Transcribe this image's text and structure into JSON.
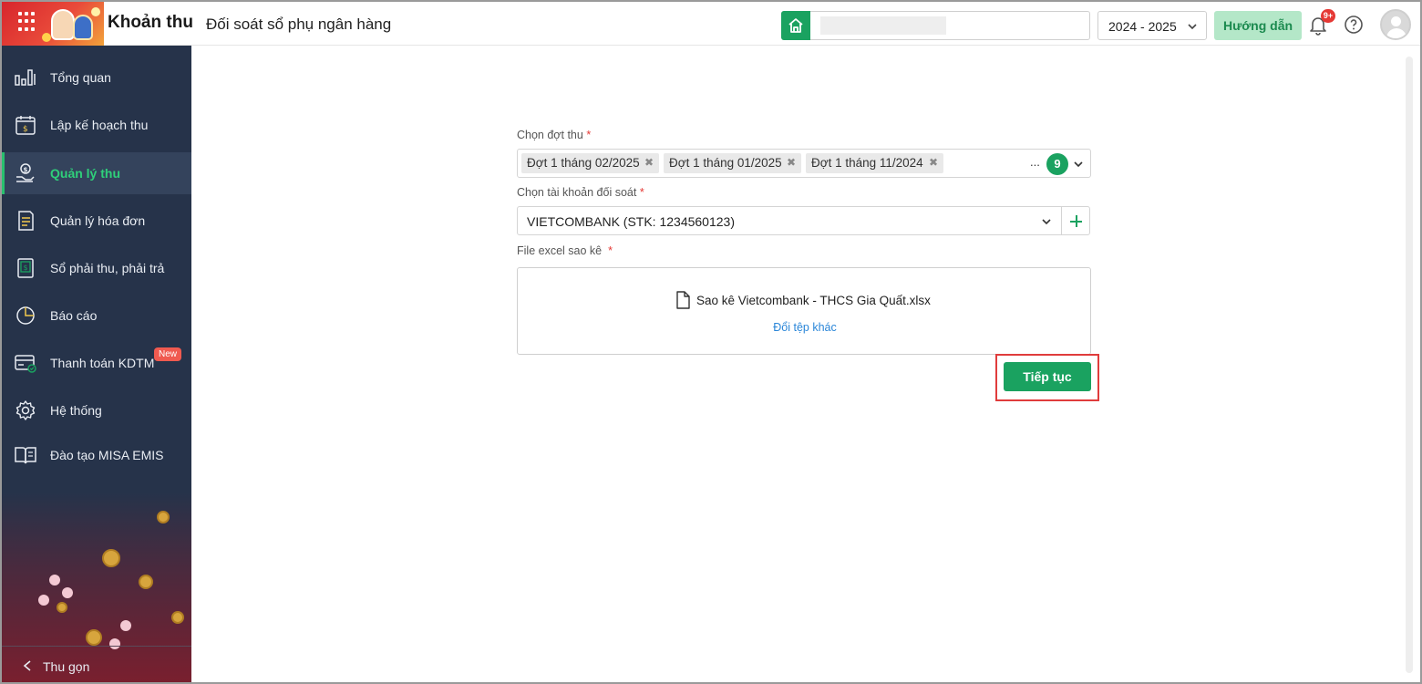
{
  "header": {
    "app_title": "Khoản thu",
    "page_title": "Đối soát sổ phụ ngân hàng",
    "school_year": "2024 - 2025",
    "guide_label": "Hướng dẫn",
    "notification_count": "9+"
  },
  "sidebar": {
    "items": [
      {
        "label": "Tổng quan",
        "icon": "bar-chart-icon"
      },
      {
        "label": "Lập kế hoạch thu",
        "icon": "calendar-money-icon"
      },
      {
        "label": "Quản lý thu",
        "icon": "hand-coin-icon",
        "active": true
      },
      {
        "label": "Quản lý hóa đơn",
        "icon": "invoice-icon"
      },
      {
        "label": "Sổ phải thu, phải trả",
        "icon": "ledger-icon"
      },
      {
        "label": "Báo cáo",
        "icon": "pie-chart-icon"
      },
      {
        "label": "Thanh toán KDTM",
        "icon": "card-payment-icon",
        "badge": "New"
      },
      {
        "label": "Hệ thống",
        "icon": "gear-icon"
      },
      {
        "label": "Đào tạo MISA EMIS",
        "icon": "book-icon"
      }
    ],
    "collapse_label": "Thu gọn"
  },
  "form": {
    "period_label": "Chọn đợt thu",
    "period_tags": [
      "Đợt 1 tháng 02/2025",
      "Đợt 1 tháng 01/2025",
      "Đợt 1 tháng 11/2024"
    ],
    "period_more": "...",
    "period_count": "9",
    "account_label": "Chọn tài khoản đối soát",
    "account_value": "VIETCOMBANK (STK: 1234560123)",
    "file_label": "File excel sao kê",
    "file_name": "Sao kê Vietcombank - THCS Gia Quất.xlsx",
    "change_file": "Đổi tệp khác",
    "required_mark": "*",
    "continue_label": "Tiếp tục"
  },
  "colors": {
    "accent": "#1aa260",
    "sidebar_bg": "#26334a",
    "active_text": "#2fd07a",
    "highlight": "#e03c3c",
    "link": "#2a86d8"
  }
}
